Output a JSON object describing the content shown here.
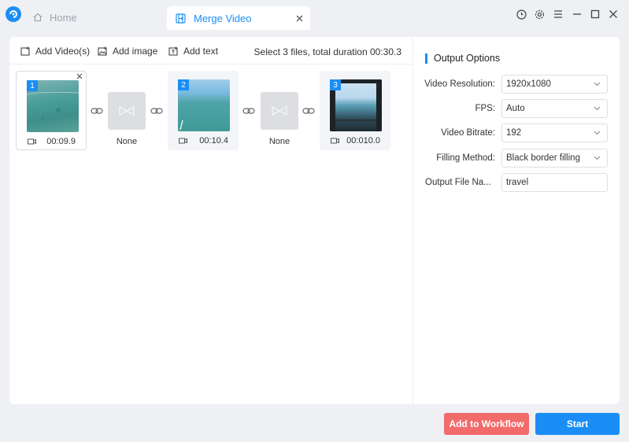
{
  "titlebar": {
    "home_tab": "Home",
    "merge_tab": "Merge Video"
  },
  "toolbar": {
    "add_videos": "Add Video(s)",
    "add_image": "Add image",
    "add_text": "Add text",
    "summary": "Select 3 files, total duration 00:30.3"
  },
  "clips": [
    {
      "number": "1",
      "duration": "00:09.9"
    },
    {
      "number": "2",
      "duration": "00:10.4"
    },
    {
      "number": "3",
      "duration": "00:010.0"
    }
  ],
  "transitions": [
    {
      "label": "None"
    },
    {
      "label": "None"
    }
  ],
  "options": {
    "title": "Output Options",
    "resolution_label": "Video Resolution:",
    "resolution_value": "1920x1080",
    "fps_label": "FPS:",
    "fps_value": "Auto",
    "bitrate_label": "Video Bitrate:",
    "bitrate_value": "192",
    "filling_label": "Filling Method:",
    "filling_value": "Black border filling",
    "filename_label": "Output File Na...",
    "filename_value": "travel"
  },
  "buttons": {
    "add_to_workflow": "Add to Workflow",
    "start": "Start"
  },
  "colors": {
    "accent": "#1a8ef5",
    "workflow": "#f26b6b"
  },
  "icons": {
    "app": "app-logo-icon",
    "home": "home-icon",
    "merge": "merge-video-icon",
    "history": "clock-icon",
    "settings": "gear-icon",
    "menu": "menu-icon",
    "minimize": "minimize-icon",
    "maximize": "maximize-icon",
    "close": "close-icon",
    "link": "link-icon",
    "transition": "transition-icon",
    "camera": "video-camera-icon",
    "chevron": "chevron-down-icon"
  }
}
